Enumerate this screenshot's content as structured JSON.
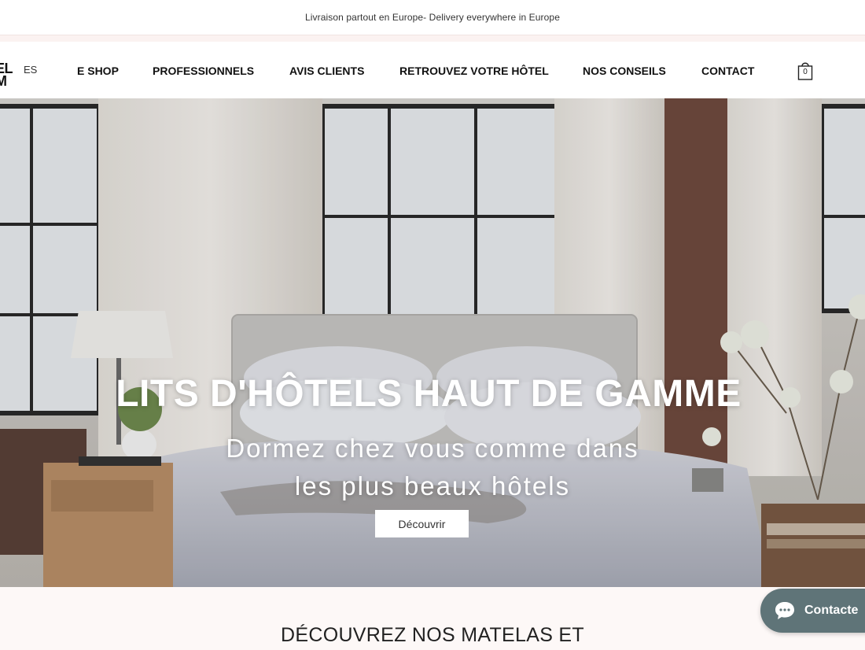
{
  "announcement": "Livraison partout en Europe- Delivery everywhere in Europe",
  "header": {
    "logo_line1": "EL",
    "logo_line2": "M",
    "lang": "ES",
    "nav": [
      {
        "label": "E SHOP"
      },
      {
        "label": "PROFESSIONNELS"
      },
      {
        "label": "AVIS CLIENTS"
      },
      {
        "label": "RETROUVEZ VOTRE HÔTEL"
      },
      {
        "label": "NOS CONSEILS"
      },
      {
        "label": "CONTACT"
      }
    ],
    "cart_count": "0",
    "cart_icon": "shopping-bag-icon"
  },
  "hero": {
    "title": "LITS D'HÔTELS HAUT DE GAMME",
    "subtitle_line1": "Dormez chez vous comme dans",
    "subtitle_line2": "les plus beaux hôtels",
    "button_label": "Découvrir",
    "image": "hotel-bedroom-photo"
  },
  "section": {
    "title": "DÉCOUVREZ NOS MATELAS ET"
  },
  "chat": {
    "label": "Contacte",
    "icon": "chat-bubble-icon"
  },
  "colors": {
    "background": "#fdf8f7",
    "chat_button": "#5f7478",
    "nav_text": "#111111"
  }
}
